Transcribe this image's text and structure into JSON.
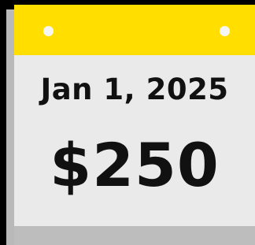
{
  "calendar": {
    "date": "Jan 1, 2025",
    "amount": "$250"
  },
  "colors": {
    "header": "#ffde00",
    "page": "#eaeaea",
    "shadow": "#bdbdbd",
    "text": "#111111",
    "background": "#000000"
  },
  "icons": {
    "ring_left": "binder-ring-hole-icon",
    "ring_right": "binder-ring-hole-icon"
  }
}
